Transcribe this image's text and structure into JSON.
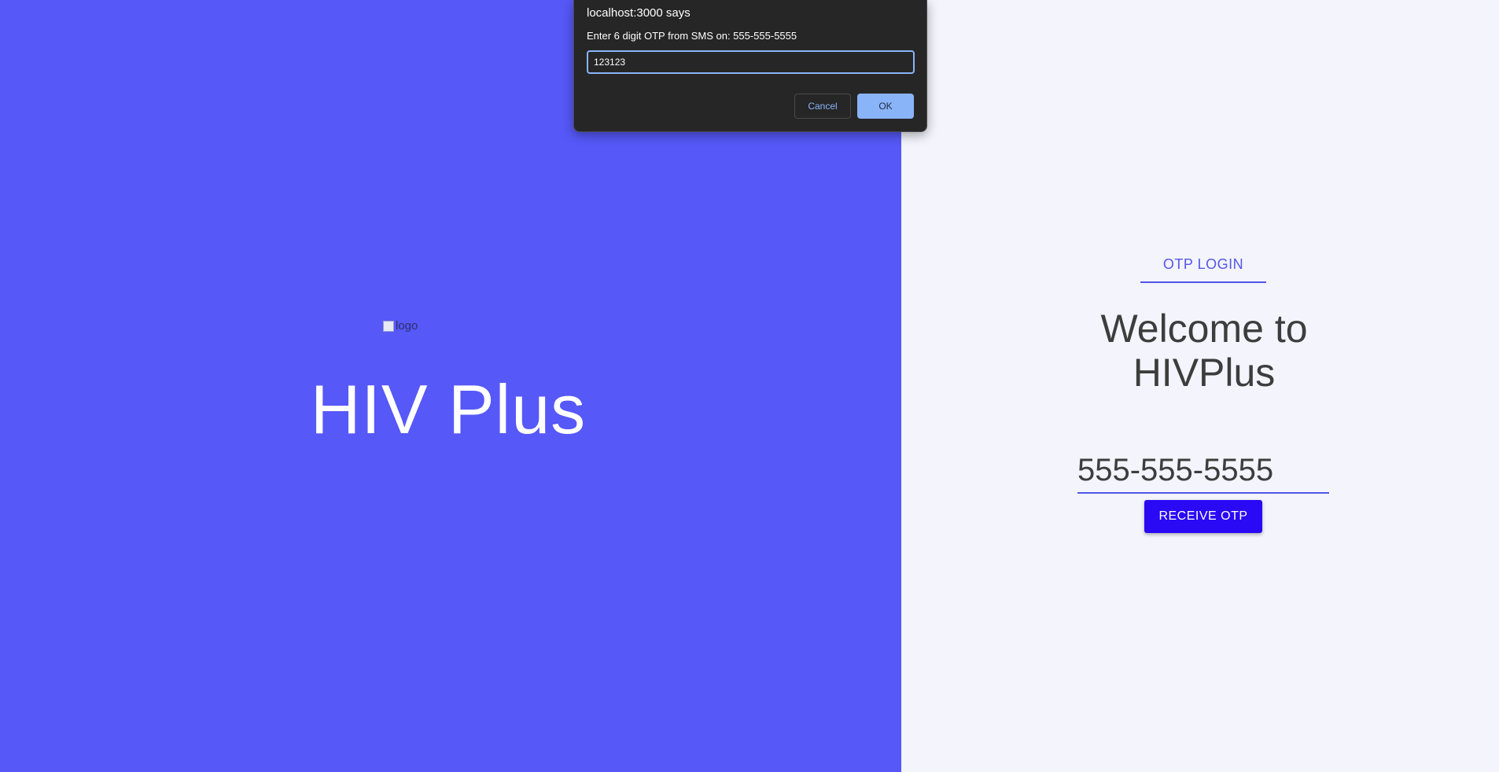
{
  "left_panel": {
    "background": "#5658f8",
    "logo_alt": "logo",
    "brand_title": "HIV Plus"
  },
  "right_panel": {
    "background": "#f3f4fc",
    "tab_label": "OTP LOGIN",
    "welcome_text": "Welcome to HIVPlus",
    "phone_value": "555-555-5555",
    "receive_button_label": "RECEIVE OTP",
    "accent_color": "#5356e8",
    "button_color": "#2a09f5"
  },
  "dialog": {
    "title": "localhost:3000 says",
    "message": "Enter 6 digit OTP from SMS on: 555-555-5555",
    "input_value": "123123",
    "cancel_label": "Cancel",
    "ok_label": "OK"
  }
}
